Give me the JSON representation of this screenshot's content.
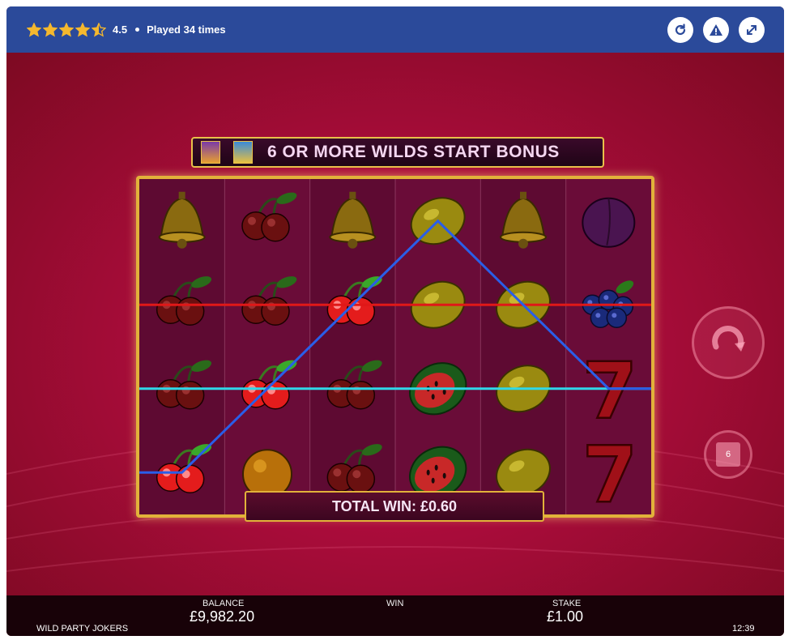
{
  "header": {
    "rating": "4.5",
    "stars_filled": 4.5,
    "played": "Played 34 times",
    "buttons": [
      {
        "name": "reload-icon"
      },
      {
        "name": "warning-icon"
      },
      {
        "name": "fullscreen-icon"
      }
    ],
    "colors": {
      "bar": "#2b4a9a",
      "star": "#f5b82e"
    }
  },
  "game": {
    "bonus_banner": "6 OR MORE WILDS START BONUS",
    "total_win": "TOTAL WIN: £0.60",
    "reels": [
      [
        "bell",
        "cherry",
        "cherry",
        "cherry-lit"
      ],
      [
        "cherry",
        "cherry",
        "cherry-lit",
        "orange"
      ],
      [
        "bell",
        "cherry-lit",
        "cherry",
        "cherry"
      ],
      [
        "lemon",
        "lemon",
        "watermelon",
        "watermelon"
      ],
      [
        "bell",
        "lemon",
        "lemon",
        "lemon"
      ],
      [
        "plum",
        "blueberry",
        "seven",
        "seven"
      ]
    ],
    "paylines": [
      {
        "color": "#e01818",
        "rows": [
          1,
          1,
          1,
          1,
          1,
          1
        ]
      },
      {
        "color": "#2fd8e8",
        "rows": [
          2,
          2,
          2,
          2,
          2,
          2
        ]
      },
      {
        "color": "#2a5ee8",
        "rows": [
          3,
          2,
          1,
          0,
          1,
          2
        ]
      }
    ],
    "spin_button_icon": "spin-icon",
    "autoplay_label": "6"
  },
  "footer": {
    "game_name": "WILD PARTY JOKERS",
    "balance_label": "BALANCE",
    "balance_value": "£9,982.20",
    "win_label": "WIN",
    "win_value": "",
    "stake_label": "STAKE",
    "stake_value": "£1.00",
    "clock": "12:39"
  }
}
